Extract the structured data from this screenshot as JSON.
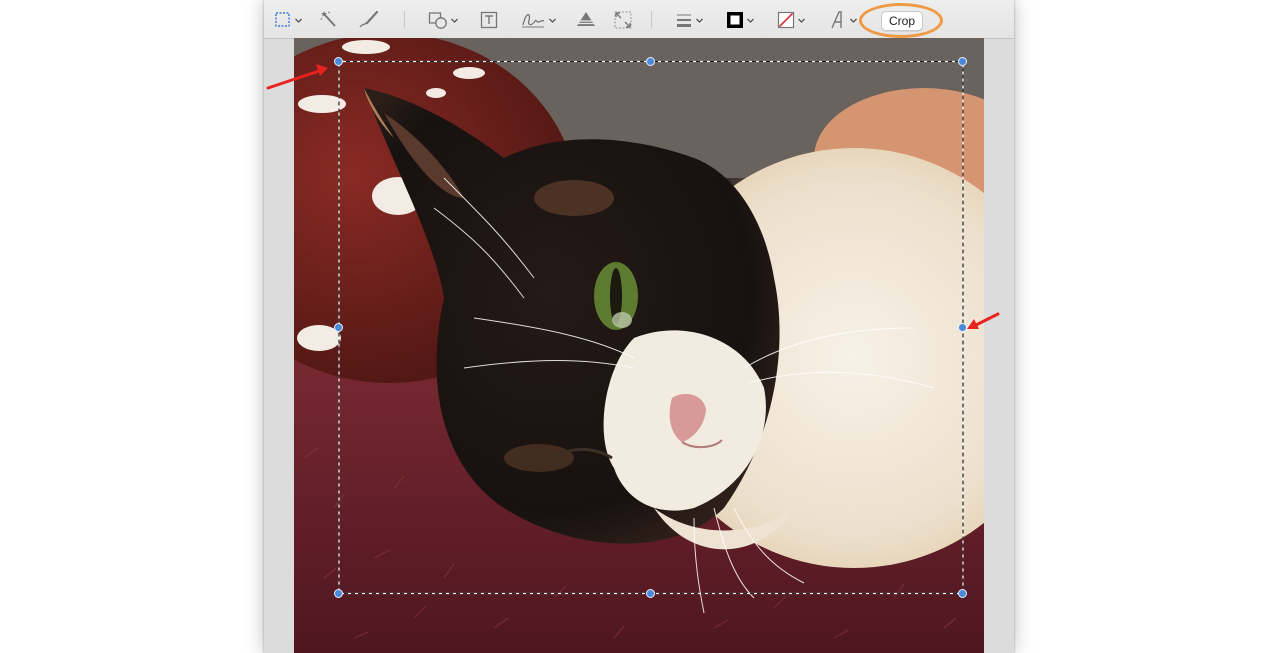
{
  "toolbar": {
    "tools": [
      {
        "name": "selection-tool",
        "icon": "rectangular-selection-icon",
        "has_menu": true
      },
      {
        "name": "instant-alpha-tool",
        "icon": "magic-wand-icon",
        "has_menu": false
      },
      {
        "name": "sketch-tool",
        "icon": "sketch-pen-icon",
        "has_menu": true
      },
      {
        "name": "shapes-tool",
        "icon": "shapes-icon",
        "has_menu": true
      },
      {
        "name": "text-tool",
        "icon": "text-box-icon",
        "has_menu": false
      },
      {
        "name": "sign-tool",
        "icon": "signature-icon",
        "has_menu": true
      },
      {
        "name": "adjust-color-tool",
        "icon": "adjust-color-icon",
        "has_menu": false
      },
      {
        "name": "adjust-size-tool",
        "icon": "adjust-size-icon",
        "has_menu": false
      },
      {
        "name": "shape-style-tool",
        "icon": "line-style-icon",
        "has_menu": true
      },
      {
        "name": "border-color-tool",
        "icon": "border-color-icon",
        "has_menu": true
      },
      {
        "name": "fill-color-tool",
        "icon": "fill-color-icon",
        "has_menu": true
      },
      {
        "name": "text-style-tool",
        "icon": "text-style-icon",
        "has_menu": true
      }
    ],
    "crop_label": "Crop"
  },
  "colors": {
    "window_bg": "#dcdcdc",
    "toolbar_bg": "#e8e8e8",
    "handle": "#4a88d8",
    "highlight_circle": "#ef9a45",
    "arrow": "#e8231f",
    "border_swatch": "#000000",
    "fill_swatch_slash": "#e0303a"
  },
  "canvas": {
    "image": "calico-cat-photo"
  }
}
